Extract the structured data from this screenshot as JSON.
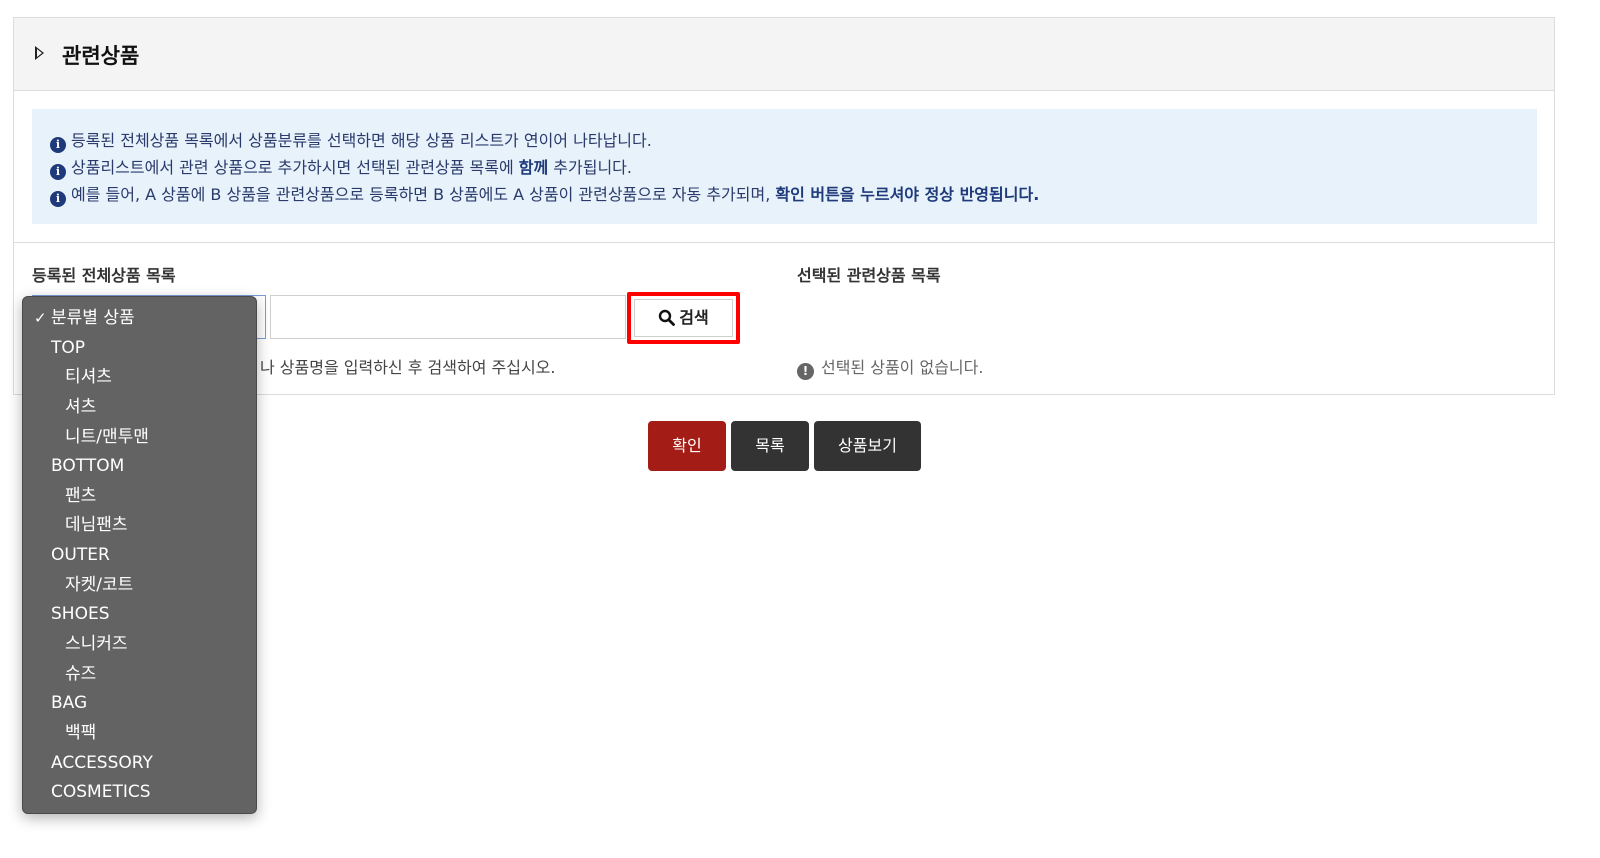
{
  "panel": {
    "title": "관련상품",
    "info": [
      {
        "text": "등록된 전체상품 목록에서 상품분류를 선택하면 해당 상품 리스트가 연이어 나타납니다.",
        "bold": ""
      },
      {
        "text": "상품리스트에서 관련 상품으로 추가하시면 선택된 관련상품 목록에 ",
        "bold": "함께",
        "after": " 추가됩니다."
      },
      {
        "text": "예를 들어, A 상품에 B 상품을 관련상품으로 등록하면 B 상품에도 A 상품이 관련상품으로 자동 추가되며, ",
        "bold": "확인 버튼을 누르셔야 정상 반영됩니다."
      }
    ],
    "info_icon": "i",
    "all_products_label": "등록된 전체상품 목록",
    "selected_products_label": "선택된 관련상품 목록",
    "search_label": "검색",
    "search_icon": "search-icon",
    "keyword_value": "",
    "hint_visible": "나 상품명을 입력하신 후 검색하여 주십시오.",
    "empty_message": "선택된 상품이 없습니다.",
    "warn_icon": "!"
  },
  "buttons": {
    "confirm": "확인",
    "list": "목록",
    "view_products": "상품보기"
  },
  "dropdown": {
    "selected": "분류별 상품",
    "check_mark": "✓",
    "options": [
      {
        "label": "분류별 상품",
        "level": 0,
        "selected": true
      },
      {
        "label": "TOP",
        "level": 0
      },
      {
        "label": "티셔츠",
        "level": 1
      },
      {
        "label": "셔츠",
        "level": 1
      },
      {
        "label": "니트/맨투맨",
        "level": 1
      },
      {
        "label": "BOTTOM",
        "level": 0
      },
      {
        "label": "팬츠",
        "level": 1
      },
      {
        "label": "데님팬츠",
        "level": 1
      },
      {
        "label": "OUTER",
        "level": 0
      },
      {
        "label": "자켓/코트",
        "level": 1
      },
      {
        "label": "SHOES",
        "level": 0
      },
      {
        "label": "스니커즈",
        "level": 1
      },
      {
        "label": "슈즈",
        "level": 1
      },
      {
        "label": "BAG",
        "level": 0
      },
      {
        "label": "백팩",
        "level": 1
      },
      {
        "label": "ACCESSORY",
        "level": 0
      },
      {
        "label": "COSMETICS",
        "level": 0
      }
    ]
  },
  "colors": {
    "info_bg": "#e8f2fb",
    "confirm_button": "#a41c16",
    "dark_button": "#333333",
    "highlight": "#ff0000",
    "dropdown_bg": "#636363"
  }
}
